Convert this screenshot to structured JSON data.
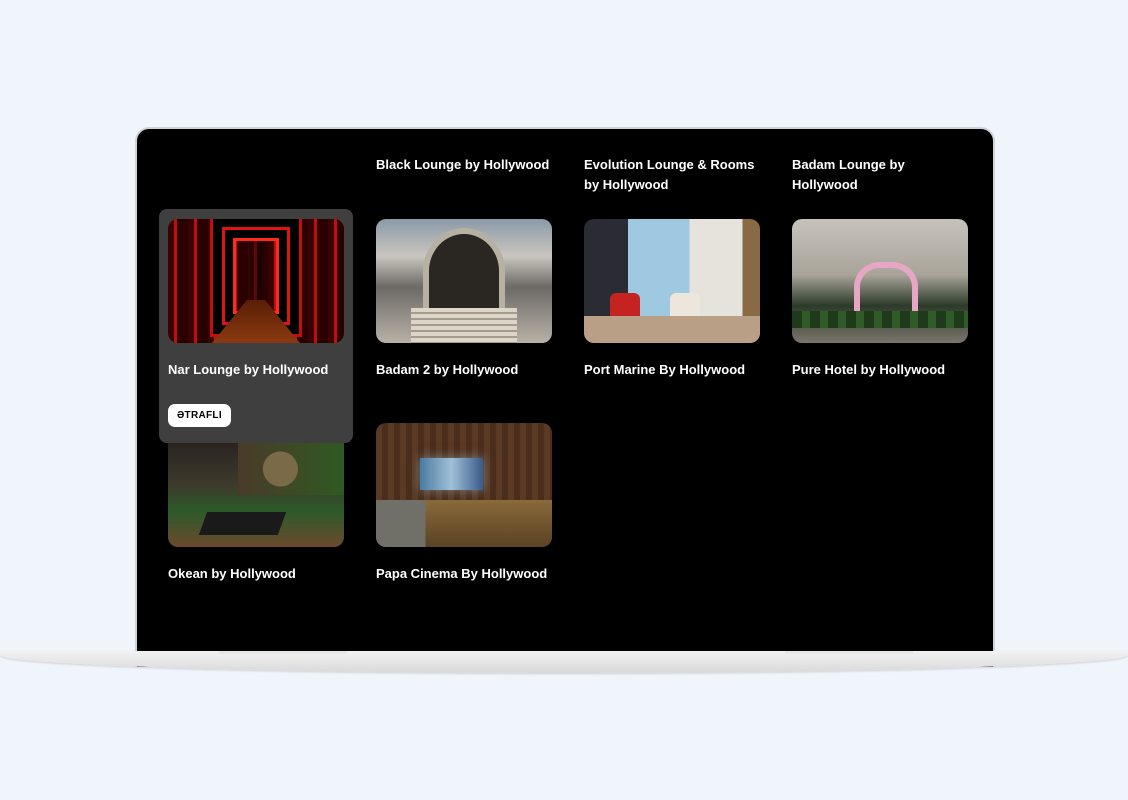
{
  "venues": {
    "header_row": [
      {
        "title": "Black Lounge by Hollywood"
      },
      {
        "title": "Evolution Lounge & Rooms by Hollywood"
      },
      {
        "title": "Badam Lounge by Hollywood"
      }
    ],
    "cards": [
      {
        "title": "Nar Lounge by Hollywood",
        "button": "ƏTRAFLI",
        "active": true
      },
      {
        "title": "Badam 2 by Hollywood"
      },
      {
        "title": "Port Marine By Hollywood"
      },
      {
        "title": "Pure Hotel by Hollywood"
      },
      {
        "title": "Okean by Hollywood"
      },
      {
        "title": "Papa Cinema By Hollywood"
      }
    ]
  },
  "colors": {
    "page_background": "#f0f4fb",
    "screen_background": "#000000",
    "active_card_background": "#3f3f3f",
    "text": "#ffffff"
  }
}
